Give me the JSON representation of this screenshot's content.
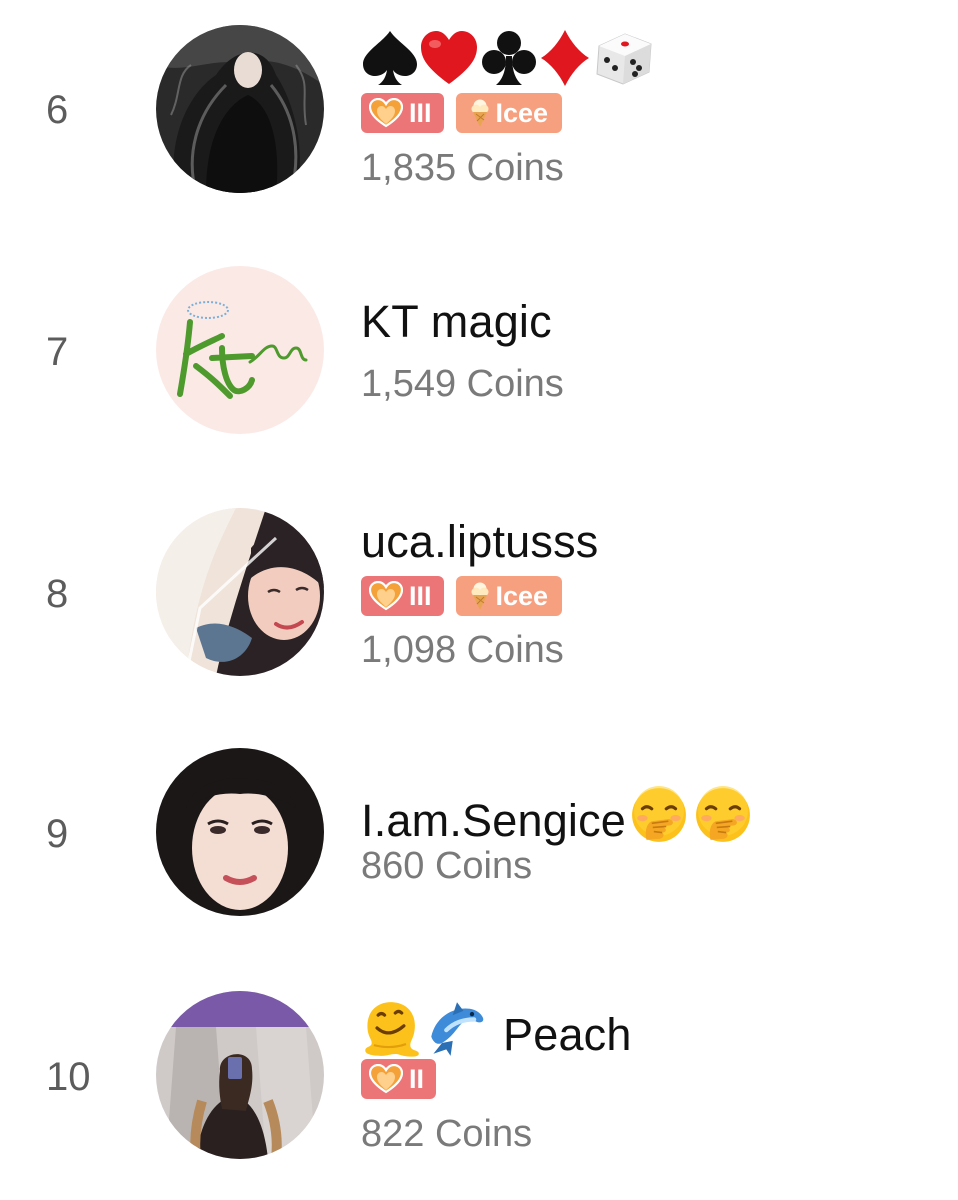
{
  "colors": {
    "badge_fan": "#ec7677",
    "badge_tier": "#f6a07f",
    "coins_text": "#7a7a7a",
    "rank_text": "#5c5c5c"
  },
  "leaderboard": {
    "entries": [
      {
        "rank": "6",
        "name": "",
        "name_icons": [
          "spade-icon",
          "heart-suit-icon",
          "club-icon",
          "diamond-icon",
          "die-icon"
        ],
        "badges": [
          {
            "type": "fan-level",
            "icon": "heart-icon",
            "label": "III"
          },
          {
            "type": "tier",
            "icon": "ice-cream-icon",
            "label": "Icee"
          }
        ],
        "coins": "1,835 Coins"
      },
      {
        "rank": "7",
        "name": "KT magic",
        "name_icons": [],
        "badges": [],
        "coins": "1,549 Coins"
      },
      {
        "rank": "8",
        "name": "uca.liptusss",
        "name_icons": [],
        "badges": [
          {
            "type": "fan-level",
            "icon": "heart-icon",
            "label": "III"
          },
          {
            "type": "tier",
            "icon": "ice-cream-icon",
            "label": "Icee"
          }
        ],
        "coins": "1,098 Coins"
      },
      {
        "rank": "9",
        "name": "I.am.Sengice",
        "name_icons": [
          "hand-over-mouth-emoji",
          "hand-over-mouth-emoji"
        ],
        "badges": [],
        "coins": "860 Coins"
      },
      {
        "rank": "10",
        "name": "Peach",
        "name_icons": [
          "melting-face-emoji",
          "dolphin-emoji"
        ],
        "badges": [
          {
            "type": "fan-level",
            "icon": "heart-icon",
            "label": "II"
          }
        ],
        "coins": "822 Coins"
      }
    ]
  }
}
